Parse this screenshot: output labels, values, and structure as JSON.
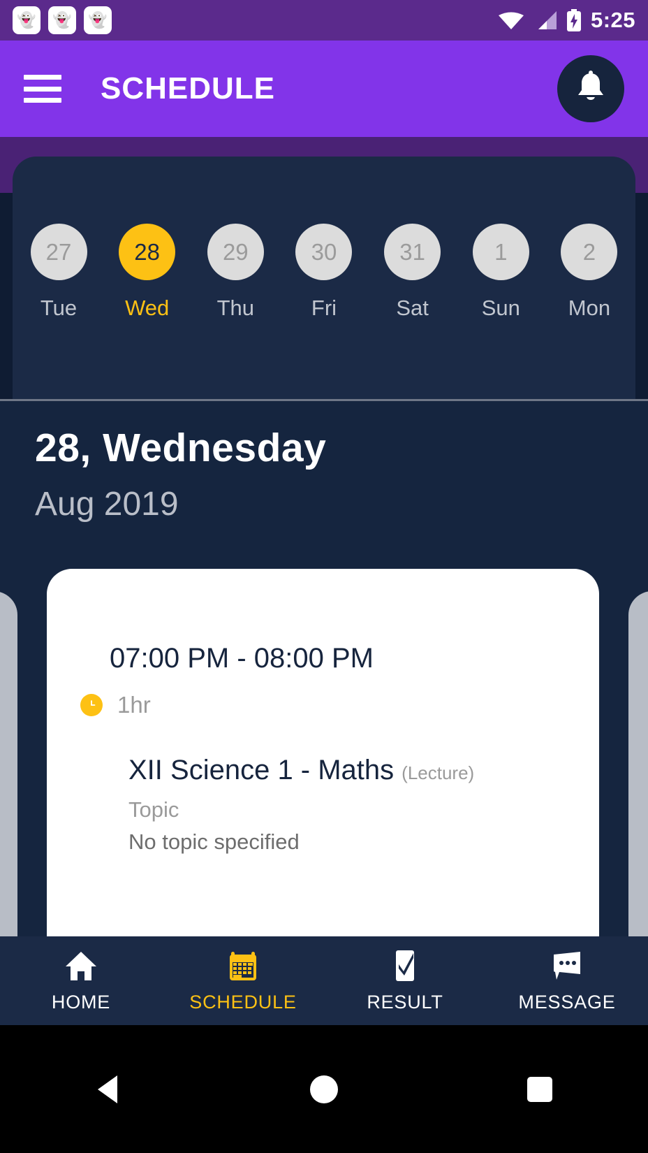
{
  "statusbar": {
    "notification_icons": [
      "app-notification-icon",
      "app-notification-icon",
      "app-notification-icon"
    ],
    "notif_glyph": "👻",
    "wifi_icon": "wifi-icon",
    "signal_icon": "cellular-signal-icon",
    "battery_icon": "battery-charging-icon",
    "time": "5:25",
    "background_color": "#5b2a8c"
  },
  "appbar": {
    "menu_icon": "hamburger-menu-icon",
    "title": "SCHEDULE",
    "notification_icon": "bell-icon",
    "background_color": "#8234e9",
    "bell_background_color": "#16243d"
  },
  "week_strip": {
    "days": [
      {
        "date": "27",
        "weekday": "Tue",
        "selected": false
      },
      {
        "date": "28",
        "weekday": "Wed",
        "selected": true
      },
      {
        "date": "29",
        "weekday": "Thu",
        "selected": false
      },
      {
        "date": "30",
        "weekday": "Fri",
        "selected": false
      },
      {
        "date": "31",
        "weekday": "Sat",
        "selected": false
      },
      {
        "date": "1",
        "weekday": "Sun",
        "selected": false
      },
      {
        "date": "2",
        "weekday": "Mon",
        "selected": false
      }
    ],
    "selected_color": "#fdc114",
    "unselected_color": "#dcdcdc",
    "card_background": "#1b2a46"
  },
  "selected_date": {
    "heading": "28, Wednesday",
    "subheading": "Aug 2019"
  },
  "event_card": {
    "time_range": "07:00 PM - 08:00 PM",
    "duration_icon": "clock-icon",
    "duration": "1hr",
    "title": "XII Science 1 - Maths",
    "type": "(Lecture)",
    "topic_label": "Topic",
    "topic_value": "No topic specified",
    "accent_color": "#fdc114"
  },
  "bottom_nav": {
    "items": [
      {
        "label": "HOME",
        "icon": "home-icon",
        "active": false
      },
      {
        "label": "SCHEDULE",
        "icon": "calendar-icon",
        "active": true
      },
      {
        "label": "RESULT",
        "icon": "result-icon",
        "active": false
      },
      {
        "label": "MESSAGE",
        "icon": "message-icon",
        "active": false
      }
    ],
    "active_color": "#fdc114",
    "inactive_color": "#ffffff",
    "background_color": "#1b2a46"
  },
  "system_nav": {
    "back_icon": "back-triangle-icon",
    "home_icon": "home-circle-icon",
    "recents_icon": "recents-square-icon"
  }
}
